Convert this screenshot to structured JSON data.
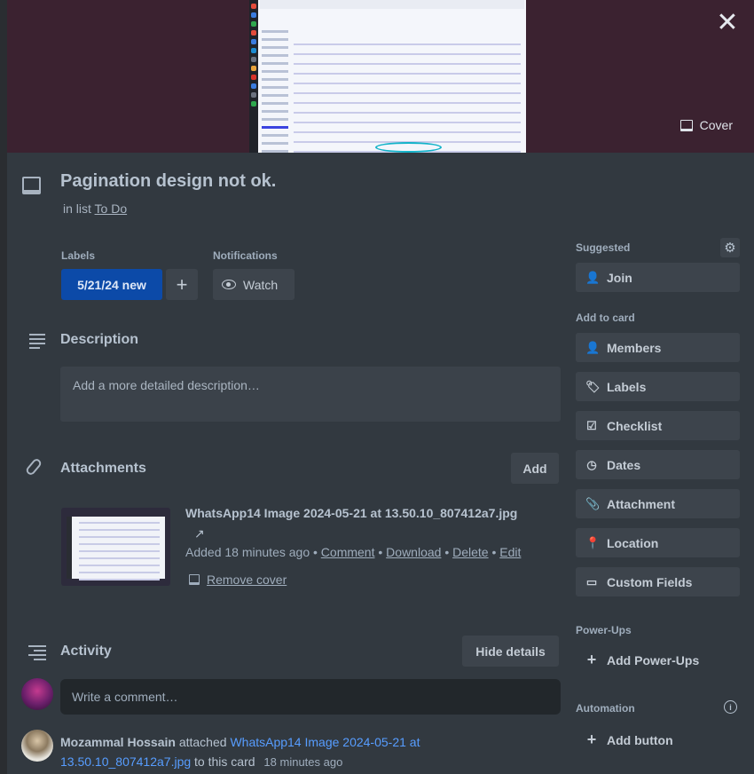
{
  "card": {
    "title": "Pagination design not ok.",
    "in_list_prefix": "in list",
    "list_name": "To Do"
  },
  "cover_button": "Cover",
  "labels_section": {
    "heading": "Labels",
    "label_text": "5/21/24 new",
    "label_color": "#0c4aa8"
  },
  "notifications_section": {
    "heading": "Notifications",
    "watch_label": "Watch"
  },
  "description": {
    "heading": "Description",
    "placeholder": "Add a more detailed description…"
  },
  "attachments": {
    "heading": "Attachments",
    "add_label": "Add",
    "item": {
      "name": "WhatsApp14 Image 2024-05-21 at 13.50.10_807412a7.jpg",
      "arrow": "↗",
      "added": "Added 18 minutes ago",
      "actions": [
        "Comment",
        "Download",
        "Delete",
        "Edit"
      ],
      "remove_cover": "Remove cover"
    }
  },
  "activity": {
    "heading": "Activity",
    "hide_details": "Hide details",
    "comment_placeholder": "Write a comment…",
    "entry": {
      "user": "Mozammal Hossain",
      "verb": "attached",
      "link": "WhatsApp14 Image 2024-05-21 at 13.50.10_807412a7.jpg",
      "suffix": "to this card",
      "time": "18 minutes ago"
    }
  },
  "sidebar": {
    "suggested_heading": "Suggested",
    "join_label": "Join",
    "add_to_card_heading": "Add to card",
    "add_items": [
      {
        "label": "Members",
        "icon": "person-icon"
      },
      {
        "label": "Labels",
        "icon": "tag-icon"
      },
      {
        "label": "Checklist",
        "icon": "checklist-icon"
      },
      {
        "label": "Dates",
        "icon": "clock-icon"
      },
      {
        "label": "Attachment",
        "icon": "paperclip-icon"
      },
      {
        "label": "Location",
        "icon": "pin-icon"
      },
      {
        "label": "Custom Fields",
        "icon": "card-icon"
      }
    ],
    "powerups_heading": "Power-Ups",
    "add_powerups": "Add Power-Ups",
    "automation_heading": "Automation",
    "add_button": "Add button"
  },
  "colors": {
    "accent_link": "#579dff",
    "panel": "#323940",
    "button": "#3d444c"
  }
}
